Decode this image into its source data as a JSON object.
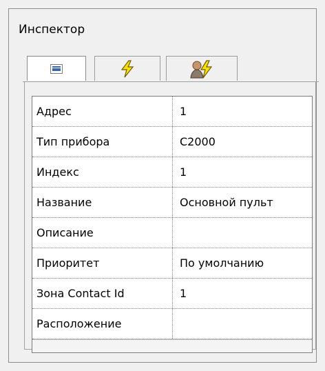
{
  "window": {
    "title": "Инспектор"
  },
  "tabs": [
    {
      "icon": "list-icon"
    },
    {
      "icon": "lightning-icon"
    },
    {
      "icon": "user-lightning-icon"
    }
  ],
  "properties": [
    {
      "label": "Адрес",
      "value": "1"
    },
    {
      "label": "Тип прибора",
      "value": "С2000"
    },
    {
      "label": "Индекс",
      "value": "1"
    },
    {
      "label": "Название",
      "value": "Основной пульт"
    },
    {
      "label": "Описание",
      "value": ""
    },
    {
      "label": "Приоритет",
      "value": "По умолчанию"
    },
    {
      "label": "Зона Contact Id",
      "value": "1"
    },
    {
      "label": "Расположение",
      "value": ""
    }
  ],
  "colors": {
    "accent_blue": "#3a67a7",
    "lightning_yellow": "#ffe100"
  }
}
